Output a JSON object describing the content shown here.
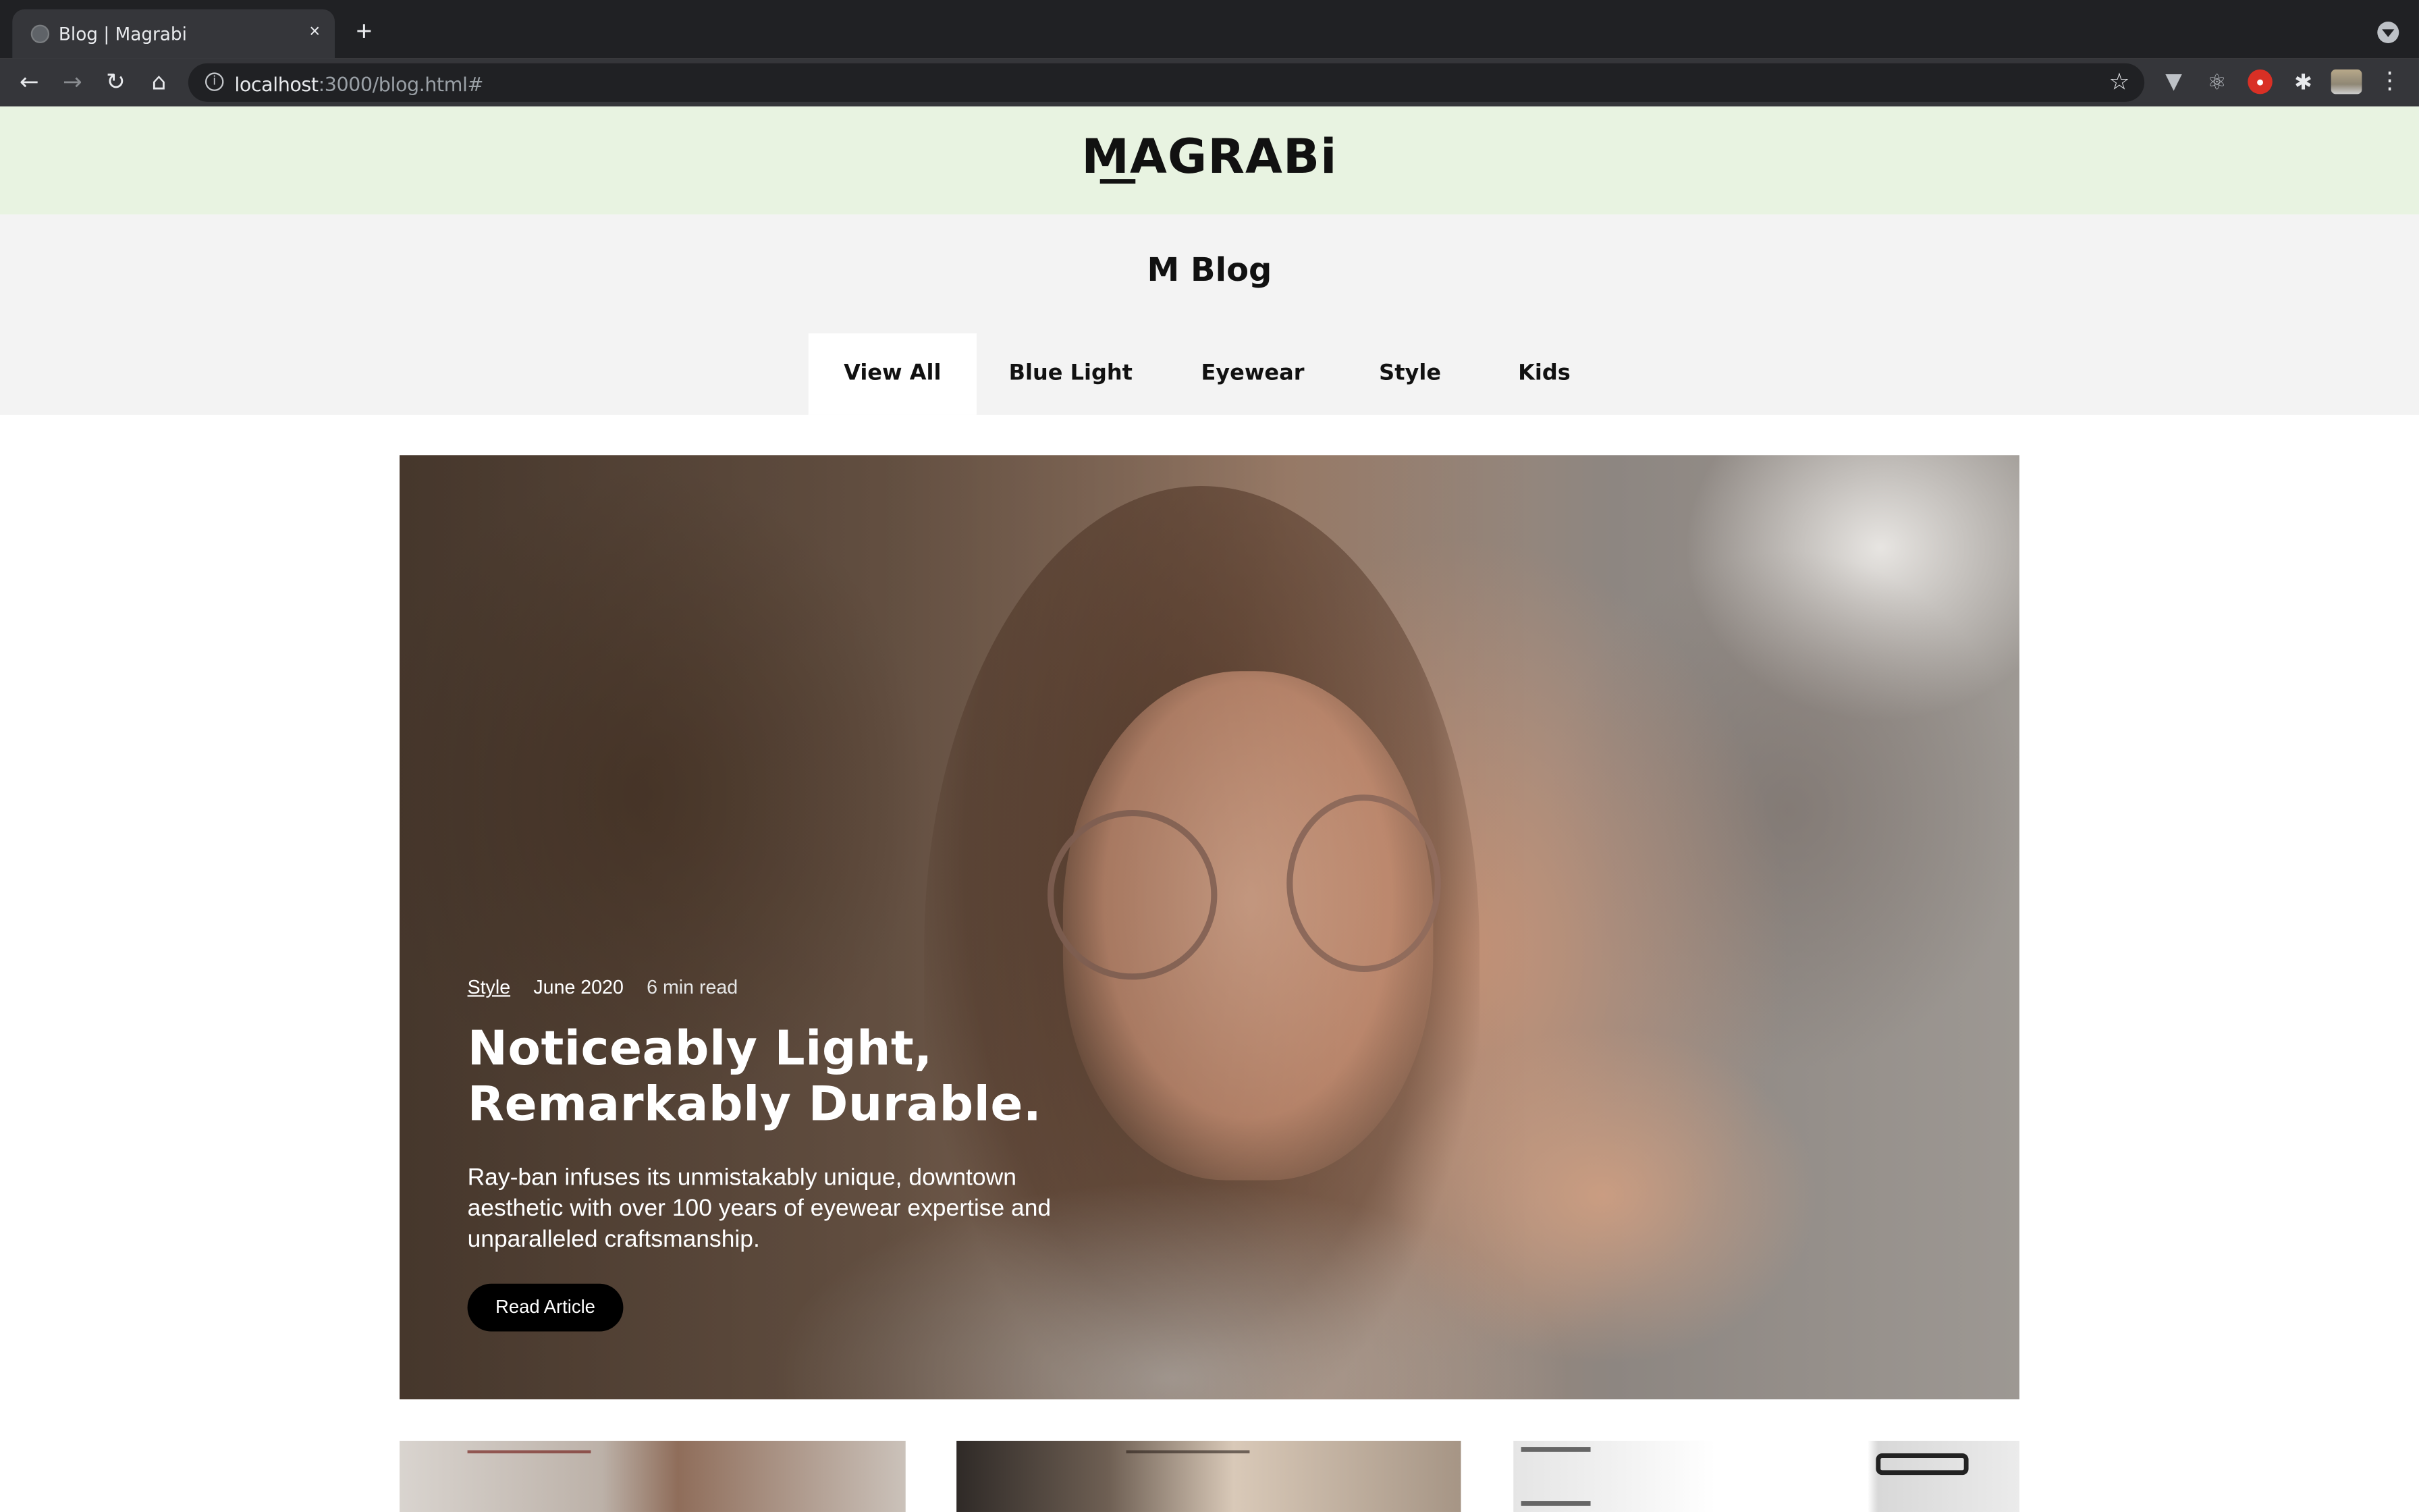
{
  "browser": {
    "tab_title": "Blog | Magrabi",
    "tab_close": "×",
    "new_tab": "+",
    "url_host": "localhost",
    "url_rest": ":3000/blog.html#",
    "icons": {
      "back": "←",
      "forward": "→",
      "reload": "↻",
      "home": "⌂",
      "star": "☆",
      "info": "i",
      "vue": "▼",
      "react": "⚛",
      "puzzle": "✱",
      "kebab": "⋮"
    }
  },
  "header": {
    "logo": "MAGRABi",
    "bg_color": "#e8f3e1"
  },
  "blog": {
    "title": "M Blog",
    "tabs": [
      {
        "label": "View All",
        "active": true
      },
      {
        "label": "Blue Light",
        "active": false
      },
      {
        "label": "Eyewear",
        "active": false
      },
      {
        "label": "Style",
        "active": false
      },
      {
        "label": "Kids",
        "active": false
      }
    ]
  },
  "featured": {
    "category": "Style",
    "date": "June 2020",
    "read_time": "6 min read",
    "title": "Noticeably Light, Remarkably Durable.",
    "description": "Ray-ban infuses its unmistakably unique, downtown aesthetic with over 100 years of eyewear expertise and unparalleled craftsmanship.",
    "button_label": "Read Article"
  }
}
